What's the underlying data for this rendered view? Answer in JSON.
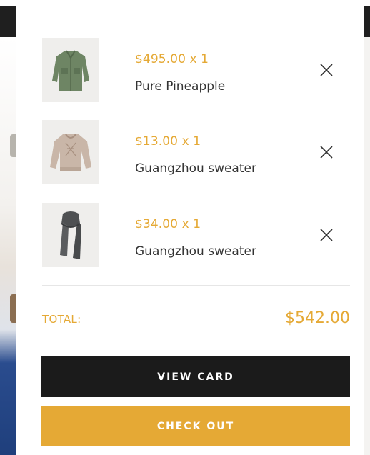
{
  "cart": {
    "items": [
      {
        "price_qty": "$495.00 x 1",
        "name": "Pure Pineapple",
        "thumbnail_icon": "green-jacket-icon"
      },
      {
        "price_qty": "$13.00 x 1",
        "name": "Guangzhou sweater",
        "thumbnail_icon": "beige-sweater-icon"
      },
      {
        "price_qty": "$34.00 x 1",
        "name": "Guangzhou sweater",
        "thumbnail_icon": "grey-scarf-icon"
      }
    ],
    "total_label": "TOTAL:",
    "total_value": "$542.00",
    "view_cart_label": "VIEW CARD",
    "checkout_label": "CHECK OUT"
  },
  "colors": {
    "accent": "#e5a935",
    "dark_button": "#1b1b1b",
    "text": "#333333"
  }
}
